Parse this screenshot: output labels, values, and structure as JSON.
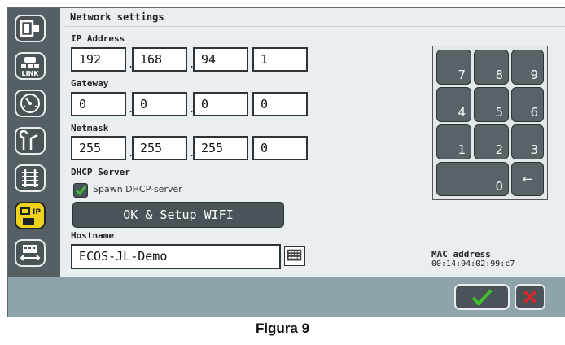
{
  "title": "Network settings",
  "ip": {
    "label": "IP Address",
    "octets": [
      "192",
      "168",
      "94",
      "1"
    ]
  },
  "gateway": {
    "label": "Gateway",
    "octets": [
      "0",
      "0",
      "0",
      "0"
    ]
  },
  "netmask": {
    "label": "Netmask",
    "octets": [
      "255",
      "255",
      "255",
      "0"
    ]
  },
  "dhcp": {
    "label": "DHCP Server",
    "checkbox_label": "Spawn DHCP-server",
    "checked": true
  },
  "ok_setup_label": "OK & Setup WIFI",
  "hostname": {
    "label": "Hostname",
    "value": "ECOS-JL-Demo"
  },
  "keypad": {
    "keys": [
      "7",
      "8",
      "9",
      "4",
      "5",
      "6",
      "1",
      "2",
      "3",
      "0",
      "←"
    ]
  },
  "mac": {
    "label": "MAC address",
    "value": "00:14:94:02:99:c7"
  },
  "sidebar": {
    "link_text": "LINK",
    "ip_text": "IP",
    "items": [
      {
        "icon": "device-icon"
      },
      {
        "icon": "link-icon"
      },
      {
        "icon": "gauge-icon"
      },
      {
        "icon": "switch-icon"
      },
      {
        "icon": "track-icon"
      },
      {
        "icon": "network-icon",
        "active": true
      },
      {
        "icon": "locomotive-icon"
      }
    ]
  },
  "colors": {
    "active_tab": "#f0d21c",
    "confirm_green": "#3fbf2f",
    "cancel_red": "#d8262a",
    "bottom_bar": "#8fa4aa"
  },
  "caption": "Figura 9"
}
